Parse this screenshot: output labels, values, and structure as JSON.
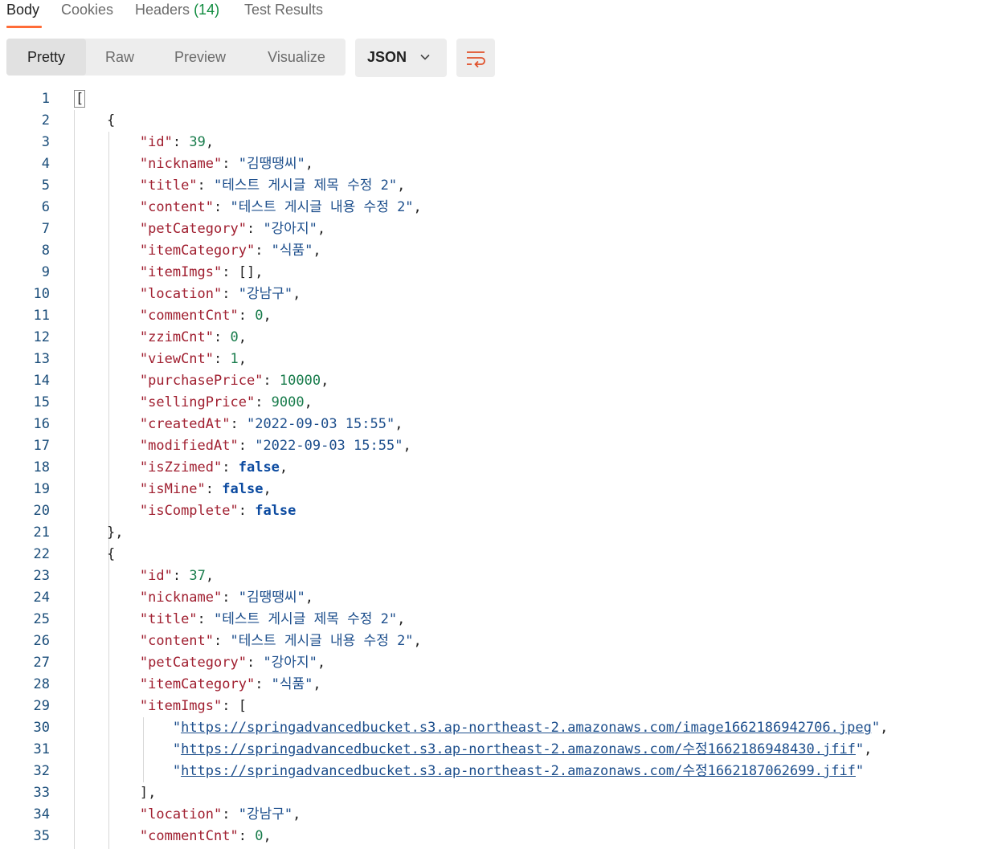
{
  "tabs": [
    {
      "label": "Body"
    },
    {
      "label": "Cookies"
    },
    {
      "label": "Headers",
      "count": "(14)"
    },
    {
      "label": "Test Results"
    }
  ],
  "toolbar": {
    "views": [
      "Pretty",
      "Raw",
      "Preview",
      "Visualize"
    ],
    "active_view": "Pretty",
    "format": "JSON",
    "icons": {
      "dropdown": "chevron-down-icon",
      "wrap": "wrap-lines-icon"
    },
    "colors": {
      "accent": "#ff6c37",
      "count_green": "#0f8b3e"
    }
  },
  "editor": {
    "colors": {
      "key": "#a01f30",
      "string": "#1c4e8c",
      "number": "#1a7d4d",
      "boolean": "#0b4aa0"
    },
    "lines": [
      {
        "indent": 0,
        "t": [
          {
            "c": "p",
            "v": "[",
            "cursor": true
          }
        ]
      },
      {
        "indent": 1,
        "t": [
          {
            "c": "p",
            "v": "{"
          }
        ]
      },
      {
        "indent": 2,
        "t": [
          {
            "c": "k",
            "v": "\"id\""
          },
          {
            "c": "p",
            "v": ": "
          },
          {
            "c": "n",
            "v": "39"
          },
          {
            "c": "p",
            "v": ","
          }
        ]
      },
      {
        "indent": 2,
        "t": [
          {
            "c": "k",
            "v": "\"nickname\""
          },
          {
            "c": "p",
            "v": ": "
          },
          {
            "c": "s",
            "v": "\"김땡땡씨\""
          },
          {
            "c": "p",
            "v": ","
          }
        ]
      },
      {
        "indent": 2,
        "t": [
          {
            "c": "k",
            "v": "\"title\""
          },
          {
            "c": "p",
            "v": ": "
          },
          {
            "c": "s",
            "v": "\"테스트 게시글 제목 수정 2\""
          },
          {
            "c": "p",
            "v": ","
          }
        ]
      },
      {
        "indent": 2,
        "t": [
          {
            "c": "k",
            "v": "\"content\""
          },
          {
            "c": "p",
            "v": ": "
          },
          {
            "c": "s",
            "v": "\"테스트 게시글 내용 수정 2\""
          },
          {
            "c": "p",
            "v": ","
          }
        ]
      },
      {
        "indent": 2,
        "t": [
          {
            "c": "k",
            "v": "\"petCategory\""
          },
          {
            "c": "p",
            "v": ": "
          },
          {
            "c": "s",
            "v": "\"강아지\""
          },
          {
            "c": "p",
            "v": ","
          }
        ]
      },
      {
        "indent": 2,
        "t": [
          {
            "c": "k",
            "v": "\"itemCategory\""
          },
          {
            "c": "p",
            "v": ": "
          },
          {
            "c": "s",
            "v": "\"식품\""
          },
          {
            "c": "p",
            "v": ","
          }
        ]
      },
      {
        "indent": 2,
        "t": [
          {
            "c": "k",
            "v": "\"itemImgs\""
          },
          {
            "c": "p",
            "v": ": [],"
          }
        ]
      },
      {
        "indent": 2,
        "t": [
          {
            "c": "k",
            "v": "\"location\""
          },
          {
            "c": "p",
            "v": ": "
          },
          {
            "c": "s",
            "v": "\"강남구\""
          },
          {
            "c": "p",
            "v": ","
          }
        ]
      },
      {
        "indent": 2,
        "t": [
          {
            "c": "k",
            "v": "\"commentCnt\""
          },
          {
            "c": "p",
            "v": ": "
          },
          {
            "c": "n",
            "v": "0"
          },
          {
            "c": "p",
            "v": ","
          }
        ]
      },
      {
        "indent": 2,
        "t": [
          {
            "c": "k",
            "v": "\"zzimCnt\""
          },
          {
            "c": "p",
            "v": ": "
          },
          {
            "c": "n",
            "v": "0"
          },
          {
            "c": "p",
            "v": ","
          }
        ]
      },
      {
        "indent": 2,
        "t": [
          {
            "c": "k",
            "v": "\"viewCnt\""
          },
          {
            "c": "p",
            "v": ": "
          },
          {
            "c": "n",
            "v": "1"
          },
          {
            "c": "p",
            "v": ","
          }
        ]
      },
      {
        "indent": 2,
        "t": [
          {
            "c": "k",
            "v": "\"purchasePrice\""
          },
          {
            "c": "p",
            "v": ": "
          },
          {
            "c": "n",
            "v": "10000"
          },
          {
            "c": "p",
            "v": ","
          }
        ]
      },
      {
        "indent": 2,
        "t": [
          {
            "c": "k",
            "v": "\"sellingPrice\""
          },
          {
            "c": "p",
            "v": ": "
          },
          {
            "c": "n",
            "v": "9000"
          },
          {
            "c": "p",
            "v": ","
          }
        ]
      },
      {
        "indent": 2,
        "t": [
          {
            "c": "k",
            "v": "\"createdAt\""
          },
          {
            "c": "p",
            "v": ": "
          },
          {
            "c": "s",
            "v": "\"2022-09-03 15:55\""
          },
          {
            "c": "p",
            "v": ","
          }
        ]
      },
      {
        "indent": 2,
        "t": [
          {
            "c": "k",
            "v": "\"modifiedAt\""
          },
          {
            "c": "p",
            "v": ": "
          },
          {
            "c": "s",
            "v": "\"2022-09-03 15:55\""
          },
          {
            "c": "p",
            "v": ","
          }
        ]
      },
      {
        "indent": 2,
        "t": [
          {
            "c": "k",
            "v": "\"isZzimed\""
          },
          {
            "c": "p",
            "v": ": "
          },
          {
            "c": "b",
            "v": "false"
          },
          {
            "c": "p",
            "v": ","
          }
        ]
      },
      {
        "indent": 2,
        "t": [
          {
            "c": "k",
            "v": "\"isMine\""
          },
          {
            "c": "p",
            "v": ": "
          },
          {
            "c": "b",
            "v": "false"
          },
          {
            "c": "p",
            "v": ","
          }
        ]
      },
      {
        "indent": 2,
        "t": [
          {
            "c": "k",
            "v": "\"isComplete\""
          },
          {
            "c": "p",
            "v": ": "
          },
          {
            "c": "b",
            "v": "false"
          }
        ]
      },
      {
        "indent": 1,
        "t": [
          {
            "c": "p",
            "v": "},"
          }
        ]
      },
      {
        "indent": 1,
        "t": [
          {
            "c": "p",
            "v": "{"
          }
        ]
      },
      {
        "indent": 2,
        "t": [
          {
            "c": "k",
            "v": "\"id\""
          },
          {
            "c": "p",
            "v": ": "
          },
          {
            "c": "n",
            "v": "37"
          },
          {
            "c": "p",
            "v": ","
          }
        ]
      },
      {
        "indent": 2,
        "t": [
          {
            "c": "k",
            "v": "\"nickname\""
          },
          {
            "c": "p",
            "v": ": "
          },
          {
            "c": "s",
            "v": "\"김땡땡씨\""
          },
          {
            "c": "p",
            "v": ","
          }
        ]
      },
      {
        "indent": 2,
        "t": [
          {
            "c": "k",
            "v": "\"title\""
          },
          {
            "c": "p",
            "v": ": "
          },
          {
            "c": "s",
            "v": "\"테스트 게시글 제목 수정 2\""
          },
          {
            "c": "p",
            "v": ","
          }
        ]
      },
      {
        "indent": 2,
        "t": [
          {
            "c": "k",
            "v": "\"content\""
          },
          {
            "c": "p",
            "v": ": "
          },
          {
            "c": "s",
            "v": "\"테스트 게시글 내용 수정 2\""
          },
          {
            "c": "p",
            "v": ","
          }
        ]
      },
      {
        "indent": 2,
        "t": [
          {
            "c": "k",
            "v": "\"petCategory\""
          },
          {
            "c": "p",
            "v": ": "
          },
          {
            "c": "s",
            "v": "\"강아지\""
          },
          {
            "c": "p",
            "v": ","
          }
        ]
      },
      {
        "indent": 2,
        "t": [
          {
            "c": "k",
            "v": "\"itemCategory\""
          },
          {
            "c": "p",
            "v": ": "
          },
          {
            "c": "s",
            "v": "\"식품\""
          },
          {
            "c": "p",
            "v": ","
          }
        ]
      },
      {
        "indent": 2,
        "t": [
          {
            "c": "k",
            "v": "\"itemImgs\""
          },
          {
            "c": "p",
            "v": ": ["
          }
        ]
      },
      {
        "indent": 3,
        "t": [
          {
            "c": "s",
            "v": "\""
          },
          {
            "c": "u",
            "v": "https://springadvancedbucket.s3.ap-northeast-2.amazonaws.com/image1662186942706.jpeg"
          },
          {
            "c": "s",
            "v": "\""
          },
          {
            "c": "p",
            "v": ","
          }
        ]
      },
      {
        "indent": 3,
        "t": [
          {
            "c": "s",
            "v": "\""
          },
          {
            "c": "u",
            "v": "https://springadvancedbucket.s3.ap-northeast-2.amazonaws.com/수정1662186948430.jfif"
          },
          {
            "c": "s",
            "v": "\""
          },
          {
            "c": "p",
            "v": ","
          }
        ]
      },
      {
        "indent": 3,
        "t": [
          {
            "c": "s",
            "v": "\""
          },
          {
            "c": "u",
            "v": "https://springadvancedbucket.s3.ap-northeast-2.amazonaws.com/수정1662187062699.jfif"
          },
          {
            "c": "s",
            "v": "\""
          }
        ]
      },
      {
        "indent": 2,
        "t": [
          {
            "c": "p",
            "v": "],"
          }
        ]
      },
      {
        "indent": 2,
        "t": [
          {
            "c": "k",
            "v": "\"location\""
          },
          {
            "c": "p",
            "v": ": "
          },
          {
            "c": "s",
            "v": "\"강남구\""
          },
          {
            "c": "p",
            "v": ","
          }
        ]
      },
      {
        "indent": 2,
        "t": [
          {
            "c": "k",
            "v": "\"commentCnt\""
          },
          {
            "c": "p",
            "v": ": "
          },
          {
            "c": "n",
            "v": "0"
          },
          {
            "c": "p",
            "v": ","
          }
        ]
      }
    ]
  }
}
